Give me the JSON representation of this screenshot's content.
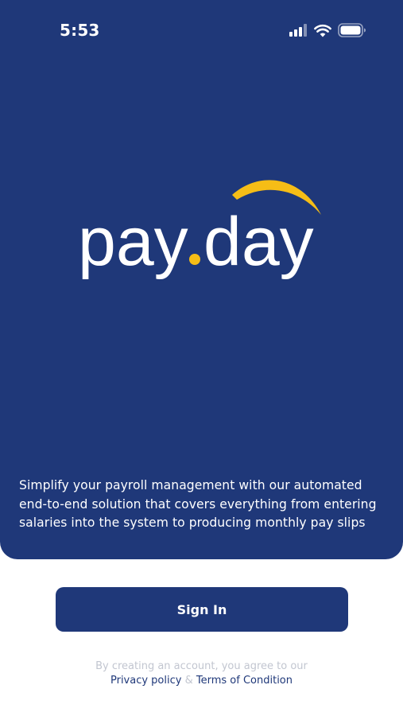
{
  "status_bar": {
    "time": "5:53",
    "icons": [
      "signal-icon",
      "wifi-icon",
      "battery-icon"
    ]
  },
  "logo": {
    "text_left": "pay",
    "dot": ".",
    "text_right": "day",
    "colors": {
      "text": "#ffffff",
      "accent": "#f6bd16"
    }
  },
  "tagline": "Simplify your payroll management with our automated end-to-end solution that covers everything from entering salaries into the system to producing monthly pay slips",
  "sign_in_label": "Sign In",
  "terms": {
    "prefix": "By creating an account, you agree to our",
    "privacy_link": "Privacy policy",
    "separator": "&",
    "terms_link": "Terms of Condition"
  },
  "colors": {
    "brand_navy": "#1f3879",
    "accent_yellow": "#f6bd16",
    "muted_text": "#c2c6d0",
    "background": "#ffffff"
  }
}
